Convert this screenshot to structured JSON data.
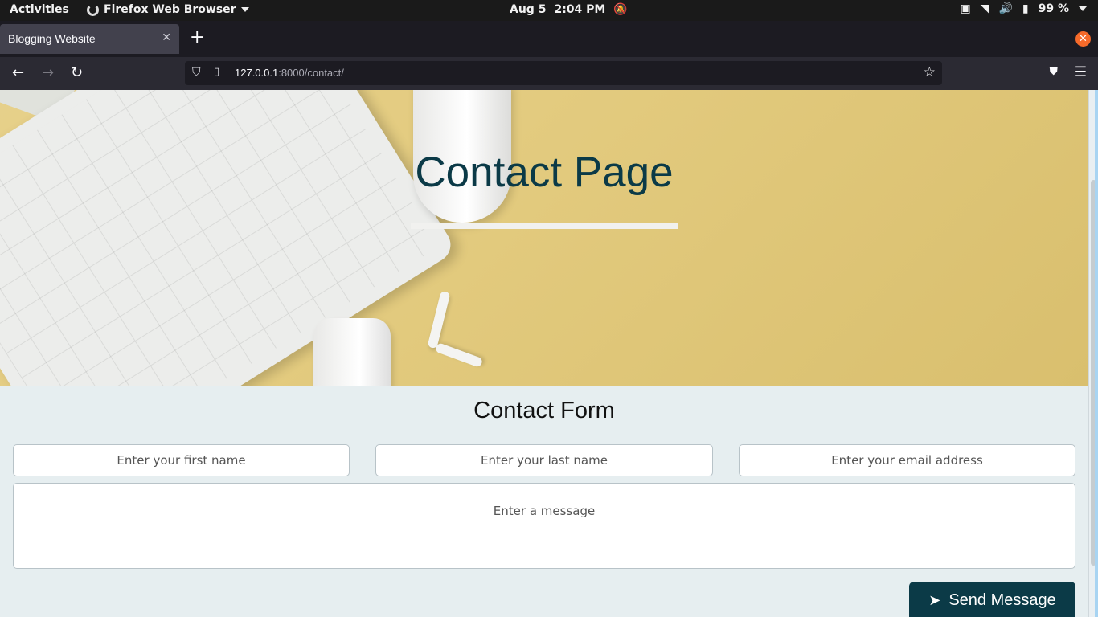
{
  "system_bar": {
    "activities": "Activities",
    "app_name": "Firefox Web Browser",
    "date": "Aug 5",
    "time": "2:04 PM",
    "battery": "99 %"
  },
  "browser": {
    "tab_title": "Blogging Website",
    "url_host": "127.0.0.1",
    "url_path": ":8000/contact/"
  },
  "page": {
    "hero_title": "Contact Page",
    "form_title": "Contact Form",
    "fields": {
      "first_name_placeholder": "Enter your first name",
      "last_name_placeholder": "Enter your last name",
      "email_placeholder": "Enter your email address",
      "message_placeholder": "Enter a message"
    },
    "send_label": "Send Message"
  },
  "colors": {
    "accent": "#0b3a47",
    "hero_bg": "#e3cb7f",
    "page_bg": "#e6eef0"
  }
}
